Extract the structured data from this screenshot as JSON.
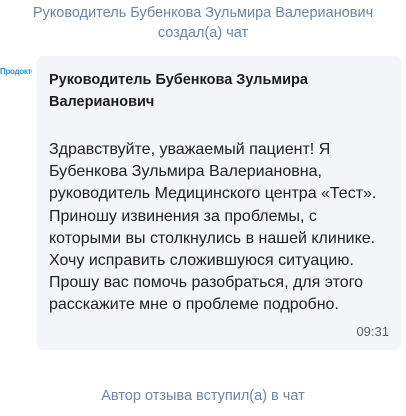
{
  "chat": {
    "created_notice": "Руководитель Бубенкова Зульмира Валерианович создал(а) чат",
    "joined_notice": "Автор отзыва вступил(а) в чат"
  },
  "message": {
    "avatar_icon": "clinic-logo",
    "avatar_logo_text": "Продокторов",
    "sender": "Руководитель Бубенкова Зульмира Валерианович",
    "text": "Здравствуйте, уважаемый пациент! Я Бубенкова Зульмира Валериановна, руководитель Медицинского центра «Тест». Приношу извинения за проблемы, с которыми вы столкнулись в нашей клинике. Хочу исправить сложившуюся ситуацию. Прошу вас помочь разобраться, для этого расскажите мне о проблеме подробно.",
    "time": "09:31"
  },
  "colors": {
    "system_note": "#6b86a6",
    "bubble_bg": "#f3f5f8",
    "logo_blue": "#2a8fd0"
  }
}
